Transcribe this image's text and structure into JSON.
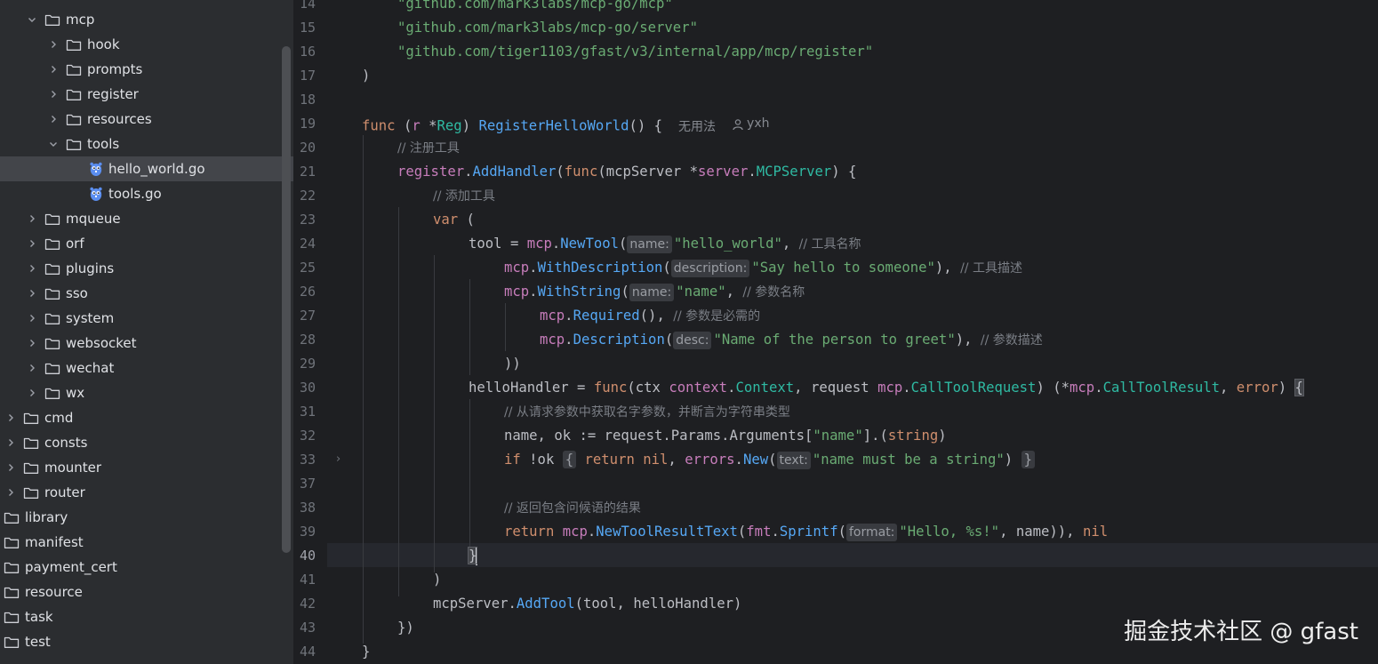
{
  "tree": {
    "items": [
      {
        "label": "mcp",
        "type": "folder",
        "depth": 1,
        "expanded": true
      },
      {
        "label": "hook",
        "type": "folder",
        "depth": 2,
        "expanded": false
      },
      {
        "label": "prompts",
        "type": "folder",
        "depth": 2,
        "expanded": false
      },
      {
        "label": "register",
        "type": "folder",
        "depth": 2,
        "expanded": false
      },
      {
        "label": "resources",
        "type": "folder",
        "depth": 2,
        "expanded": false
      },
      {
        "label": "tools",
        "type": "folder",
        "depth": 2,
        "expanded": true
      },
      {
        "label": "hello_world.go",
        "type": "gofile",
        "depth": 3,
        "selected": true
      },
      {
        "label": "tools.go",
        "type": "gofile",
        "depth": 3
      },
      {
        "label": "mqueue",
        "type": "folder",
        "depth": 1,
        "expanded": false
      },
      {
        "label": "orf",
        "type": "folder",
        "depth": 1,
        "expanded": false
      },
      {
        "label": "plugins",
        "type": "folder",
        "depth": 1,
        "expanded": false
      },
      {
        "label": "sso",
        "type": "folder",
        "depth": 1,
        "expanded": false
      },
      {
        "label": "system",
        "type": "folder",
        "depth": 1,
        "expanded": false
      },
      {
        "label": "websocket",
        "type": "folder",
        "depth": 1,
        "expanded": false
      },
      {
        "label": "wechat",
        "type": "folder",
        "depth": 1,
        "expanded": false
      },
      {
        "label": "wx",
        "type": "folder",
        "depth": 1,
        "expanded": false
      },
      {
        "label": "cmd",
        "type": "folder",
        "depth": 0,
        "expanded": false
      },
      {
        "label": "consts",
        "type": "folder",
        "depth": 0,
        "expanded": false
      },
      {
        "label": "mounter",
        "type": "folder",
        "depth": 0,
        "expanded": false
      },
      {
        "label": "router",
        "type": "folder",
        "depth": 0,
        "expanded": false
      },
      {
        "label": "library",
        "type": "folder",
        "depth": -1
      },
      {
        "label": "manifest",
        "type": "folder",
        "depth": -1
      },
      {
        "label": "payment_cert",
        "type": "folder",
        "depth": -1
      },
      {
        "label": "resource",
        "type": "folder",
        "depth": -1
      },
      {
        "label": "task",
        "type": "folder",
        "depth": -1
      },
      {
        "label": "test",
        "type": "folder",
        "depth": -1
      }
    ]
  },
  "editor": {
    "line_numbers": [
      "14",
      "15",
      "16",
      "17",
      "18",
      "19",
      "20",
      "21",
      "22",
      "23",
      "24",
      "25",
      "26",
      "27",
      "28",
      "29",
      "30",
      "31",
      "32",
      "33",
      "37",
      "38",
      "39",
      "40",
      "41",
      "42",
      "43",
      "44"
    ],
    "current_line": "40",
    "imports": [
      "\"github.com/mark3labs/mcp-go/mcp\"",
      "\"github.com/mark3labs/mcp-go/server\"",
      "\"github.com/tiger1103/gfast/v3/internal/app/mcp/register\""
    ],
    "usages_hint": "无用法",
    "author_hint": "yxh",
    "comments": {
      "c20": "// 注册工具",
      "c22": "// 添加工具",
      "c24": "// 工具名称",
      "c25": "// 工具描述",
      "c26": "// 参数名称",
      "c27": "// 参数是必需的",
      "c28": "// 参数描述",
      "c31": "// 从请求参数中获取名字参数，并断言为字符串类型",
      "c38": "// 返回包含问候语的结果"
    },
    "hints": {
      "name": "name:",
      "description": "description:",
      "desc": "desc:",
      "text": "text:",
      "format": "format:"
    },
    "strings": {
      "hello_world": "\"hello_world\"",
      "say_hello": "\"Say hello to someone\"",
      "name": "\"name\"",
      "name_desc": "\"Name of the person to greet\"",
      "name_key": "\"name\"",
      "must_be": "\"name must be a string\"",
      "hello_fmt": "\"Hello, %s!\""
    }
  },
  "watermark": "掘金技术社区 @ gfast"
}
